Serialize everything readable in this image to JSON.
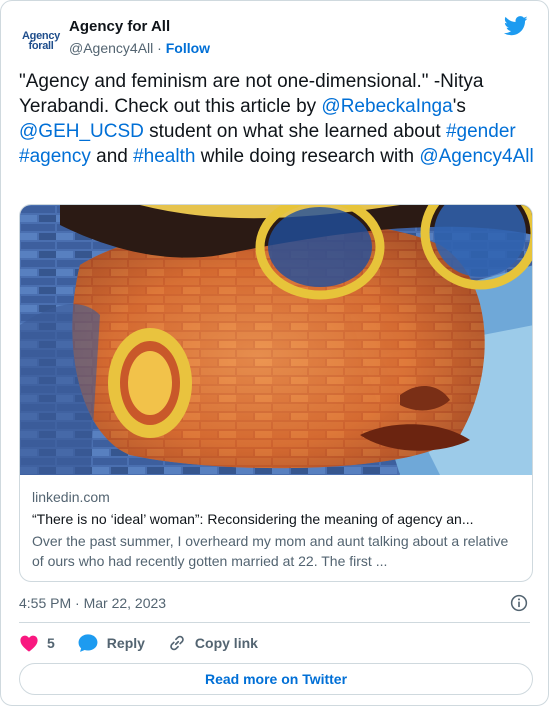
{
  "author": {
    "avatar_line1": "Agency",
    "avatar_line2": "forall",
    "display_name": "Agency for All",
    "handle": "@Agency4All",
    "separator": " · ",
    "follow_label": "Follow"
  },
  "tweet": {
    "parts": [
      {
        "text": "\"Agency and feminism are not one-dimensional.\" -Nitya Yerabandi. Check out this article by ",
        "link": false
      },
      {
        "text": "@RebeckaInga",
        "link": true
      },
      {
        "text": "'s ",
        "link": false
      },
      {
        "text": "@GEH_UCSD",
        "link": true
      },
      {
        "text": " student on what she learned about ",
        "link": false
      },
      {
        "text": "#gender",
        "link": true
      },
      {
        "text": " ",
        "link": false
      },
      {
        "text": "#agency",
        "link": true
      },
      {
        "text": " and ",
        "link": false
      },
      {
        "text": "#health",
        "link": true
      },
      {
        "text": " while doing research with ",
        "link": false
      },
      {
        "text": "@Agency4All",
        "link": true
      }
    ]
  },
  "link_card": {
    "domain": "linkedin.com",
    "title": "“There is no ‘ideal’ woman”: Reconsidering the meaning of agency an...",
    "description": "Over the past summer, I overheard my mom and aunt talking about a relative of ours who had recently gotten married at 22. The first ..."
  },
  "meta": {
    "timestamp": "4:55 PM · Mar 22, 2023"
  },
  "actions": {
    "like_count": "5",
    "reply_label": "Reply",
    "copy_label": "Copy link"
  },
  "read_more_label": "Read more on Twitter",
  "colors": {
    "link_blue": "#006fd6",
    "twitter_blue": "#1d9bf0",
    "like_red": "#f91880",
    "border": "#cfd9de"
  }
}
